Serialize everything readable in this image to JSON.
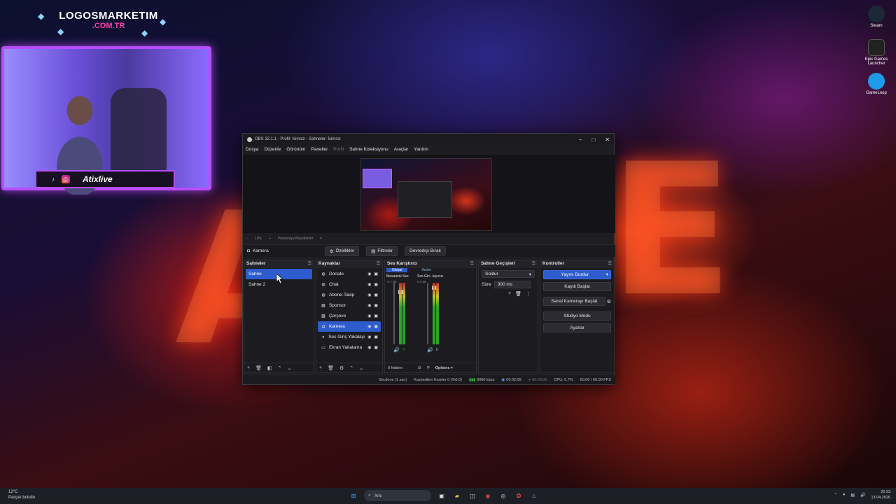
{
  "overlay": {
    "brand_title": "LOGOSMARKETIM",
    "brand_sub": ".COM.TR",
    "streamer_name": "Atixlive",
    "social_label": "TIKTOK"
  },
  "desktop_icons": [
    {
      "label": "Steam",
      "color": "#1b2838"
    },
    {
      "label": "Epic Games Launcher",
      "color": "#222222"
    },
    {
      "label": "GameLoop",
      "color": "#1e9be8"
    }
  ],
  "obs": {
    "title": "OBS 32.1.1 - Profil: İsimsiz - Sahneler: İsimsiz",
    "menu": [
      "Dosya",
      "Düzenle",
      "Görünüm",
      "Paneller",
      "Profil",
      "Sahne Koleksiyonu",
      "Araçlar",
      "Yardım"
    ],
    "preview_toolbar": {
      "zoom": "19%",
      "scaling": "Pencereye Boyutlandır"
    },
    "source_bar": {
      "current_source": "Kamera",
      "properties": "Özellikler",
      "filters": "Filtreler",
      "deactivate": "Devredışı Bırak"
    },
    "scenes": {
      "header": "Sahneler",
      "items": [
        {
          "label": "Sahne",
          "selected": true
        },
        {
          "label": "Sahne 2",
          "selected": false
        }
      ]
    },
    "sources": {
      "header": "Kaynaklar",
      "items": [
        {
          "label": "Donate",
          "icon": "globe-icon",
          "selected": false
        },
        {
          "label": "Chat",
          "icon": "globe-icon",
          "selected": false
        },
        {
          "label": "Abone-Takip",
          "icon": "globe-icon",
          "selected": false
        },
        {
          "label": "Sponsor",
          "icon": "image-icon",
          "selected": false
        },
        {
          "label": "Çerçeve",
          "icon": "image-icon",
          "selected": false
        },
        {
          "label": "Kamera",
          "icon": "camera-icon",
          "selected": true
        },
        {
          "label": "Ses Giriş Yakalayıcı",
          "icon": "microphone-icon",
          "selected": false
        },
        {
          "label": "Ekran Yakalama",
          "icon": "monitor-icon",
          "selected": false
        }
      ]
    },
    "mixer": {
      "header": "Ses Karıştırıcı",
      "tab_global": "Global",
      "tab_active": "Active",
      "channels": [
        {
          "name": "Masaüstü Ses",
          "db": "-8.7 dB",
          "level": 0.55
        },
        {
          "name": "Ses Giri...layıcısı",
          "db": "0.0 dB",
          "level": 0.62
        }
      ],
      "hidden_count": "0 hidden",
      "options": "Options"
    },
    "transitions": {
      "header": "Sahne Geçişleri",
      "type": "Soldur",
      "duration_label": "Süre",
      "duration_value": "300 ms"
    },
    "controls": {
      "header": "Kontroller",
      "stop_stream": "Yayını Durdur",
      "start_recording": "Kaydı Başlat",
      "start_virtual_cam": "Sanal Kamerayı Başlat",
      "studio_mode": "Stüdyo Modu",
      "settings": "Ayarlar"
    },
    "status": {
      "delay": "Gecikme (1 san)",
      "dropped": "Kaybedilen Kareler 0 (%0.0)",
      "bitrate": "8090 kbps",
      "stream_time": "00:32:09",
      "record_time": "00:00:00",
      "cpu": "CPU: 0.7%",
      "fps": "60.00 / 60.00 FPS"
    }
  },
  "taskbar": {
    "weather_temp": "12°C",
    "weather_desc": "Parçalı bulutlu",
    "search_label": "Ara",
    "time": "22:23",
    "date": "13.04.2026"
  }
}
